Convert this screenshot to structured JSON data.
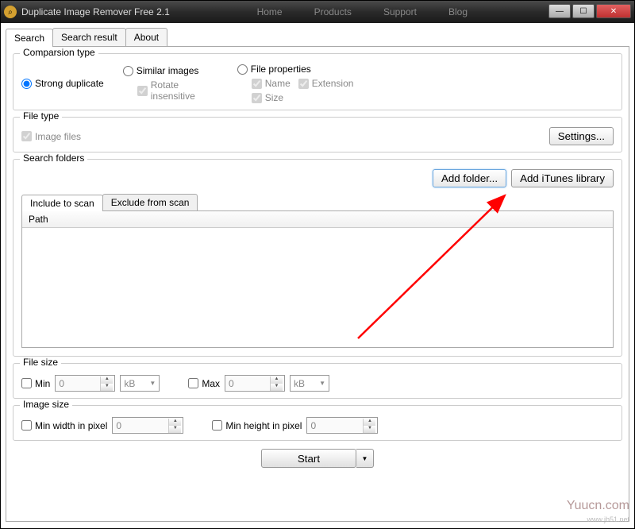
{
  "window": {
    "title": "Duplicate Image Remover Free 2.1"
  },
  "menu": {
    "home": "Home",
    "products": "Products",
    "support": "Support",
    "blog": "Blog"
  },
  "tabs": {
    "search": "Search",
    "result": "Search result",
    "about": "About"
  },
  "comparison": {
    "title": "Comparsion type",
    "strong": "Strong duplicate",
    "similar": "Similar images",
    "rotate": "Rotate insensitive",
    "fileprops": "File properties",
    "name": "Name",
    "extension": "Extension",
    "size": "Size"
  },
  "filetype": {
    "title": "File type",
    "images": "Image files",
    "settings_btn": "Settings..."
  },
  "folders": {
    "title": "Search folders",
    "add_folder": "Add folder...",
    "add_itunes": "Add iTunes library",
    "include_tab": "Include to scan",
    "exclude_tab": "Exclude from scan",
    "path_header": "Path"
  },
  "filesize": {
    "title": "File size",
    "min": "Min",
    "max": "Max",
    "val0": "0",
    "unit": "kB"
  },
  "imagesize": {
    "title": "Image size",
    "minw": "Min width in pixel",
    "minh": "Min height in pixel",
    "val0": "0"
  },
  "start": {
    "label": "Start"
  },
  "watermark": {
    "brand": "Yuucn.com",
    "url": "www.jb51.net"
  }
}
